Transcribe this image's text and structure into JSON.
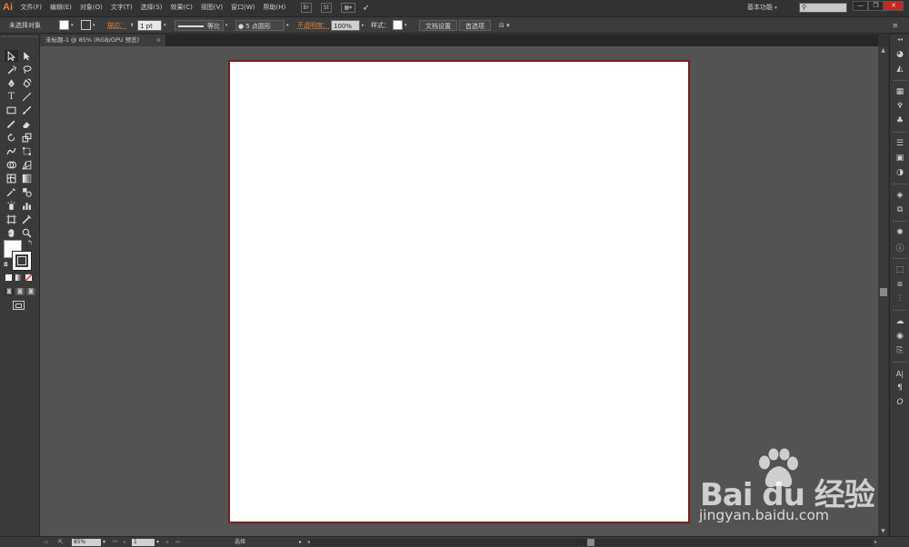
{
  "app": {
    "logo": "Ai",
    "accent": "#e1803c"
  },
  "menubar": {
    "items": [
      "文件(F)",
      "编辑(E)",
      "对象(O)",
      "文字(T)",
      "选择(S)",
      "效果(C)",
      "视图(V)",
      "窗口(W)",
      "帮助(H)"
    ],
    "icons": [
      "bridge-icon",
      "stock-icon",
      "arrange-documents-icon",
      "rocket-icon"
    ],
    "workspace": "基本功能",
    "bridge_label": "Br",
    "stock_label": "St"
  },
  "controlbar": {
    "selection_label": "未选择对象",
    "stroke_label": "描边：",
    "stroke_weight": "1 pt",
    "stroke_profile": "等比",
    "brush": "5 点圆形",
    "opacity_label": "不透明度：",
    "opacity": "100%",
    "style_label": "样式：",
    "doc_setup": "文档设置",
    "preferences": "首选项"
  },
  "tab": {
    "title": "未标题-1 @ 85% (RGB/GPU 预览)",
    "close": "×"
  },
  "statusbar": {
    "zoom": "85%",
    "artboard": "1",
    "mode": "选择"
  },
  "watermark": {
    "logo": "Bai du 经验",
    "url": "jingyan.baidu.com"
  },
  "colors": {
    "artboard_border": "#7a1e1e",
    "canvas": "#535353",
    "panel": "#3a3a3a"
  }
}
